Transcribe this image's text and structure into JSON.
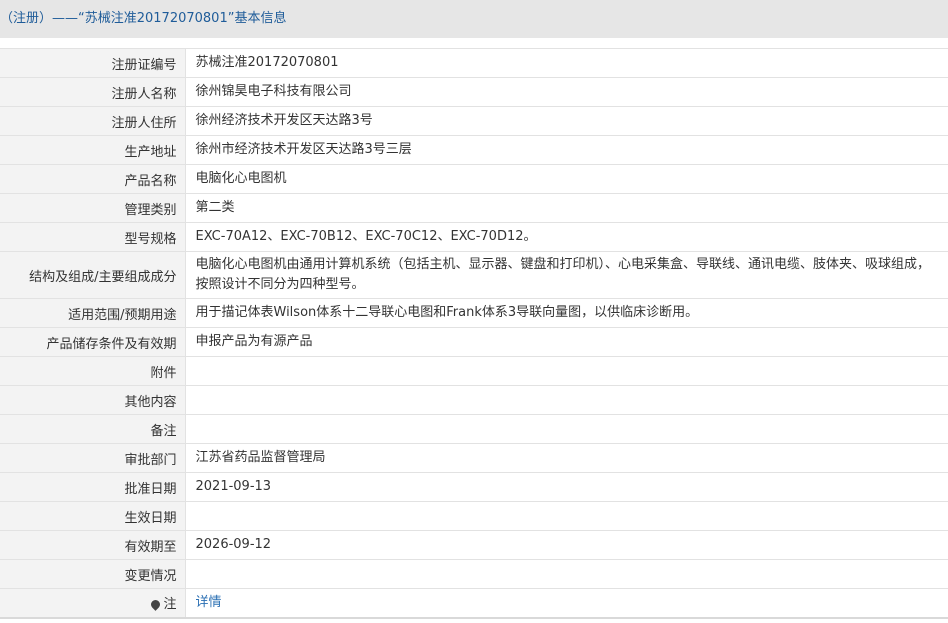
{
  "title": "（注册）——“苏械注准20172070801”基本信息",
  "rows": [
    {
      "label": "注册证编号",
      "value": "苏械注准20172070801"
    },
    {
      "label": "注册人名称",
      "value": "徐州锦昊电子科技有限公司"
    },
    {
      "label": "注册人住所",
      "value": "徐州经济技术开发区天达路3号"
    },
    {
      "label": "生产地址",
      "value": "徐州市经济技术开发区天达路3号三层"
    },
    {
      "label": "产品名称",
      "value": "电脑化心电图机"
    },
    {
      "label": "管理类别",
      "value": "第二类"
    },
    {
      "label": "型号规格",
      "value": "EXC-70A12、EXC-70B12、EXC-70C12、EXC-70D12。"
    },
    {
      "label": "结构及组成/主要组成成分",
      "value": "电脑化心电图机由通用计算机系统（包括主机、显示器、键盘和打印机）、心电采集盒、导联线、通讯电缆、肢体夹、吸球组成，按照设计不同分为四种型号。"
    },
    {
      "label": "适用范围/预期用途",
      "value": "用于描记体表Wilson体系十二导联心电图和Frank体系3导联向量图，以供临床诊断用。"
    },
    {
      "label": "产品储存条件及有效期",
      "value": "申报产品为有源产品"
    },
    {
      "label": "附件",
      "value": ""
    },
    {
      "label": "其他内容",
      "value": ""
    },
    {
      "label": "备注",
      "value": ""
    },
    {
      "label": "审批部门",
      "value": "江苏省药品监督管理局"
    },
    {
      "label": "批准日期",
      "value": "2021-09-13"
    },
    {
      "label": "生效日期",
      "value": ""
    },
    {
      "label": "有效期至",
      "value": "2026-09-12"
    },
    {
      "label": "变更情况",
      "value": ""
    }
  ],
  "note": {
    "label": "注",
    "icon": "pin-icon",
    "link_text": "详情"
  }
}
